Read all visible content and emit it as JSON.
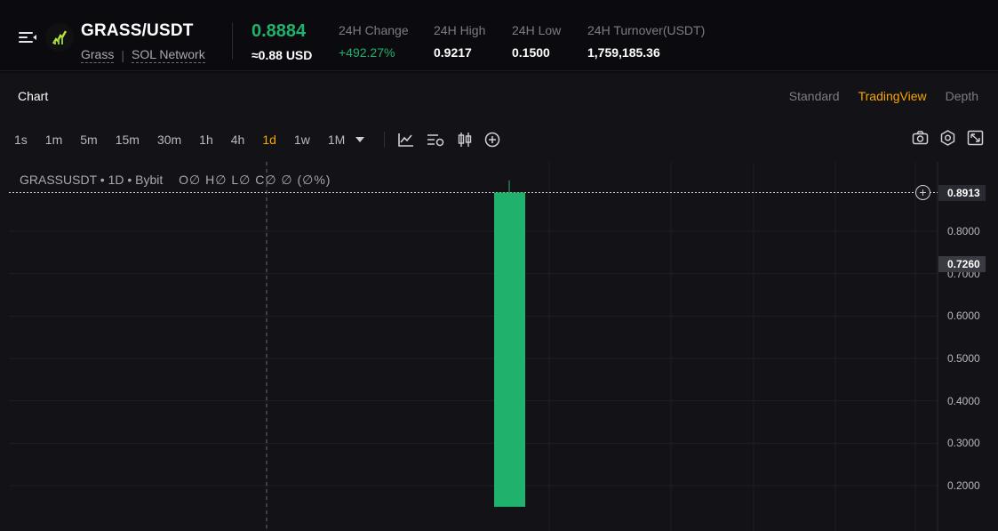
{
  "header": {
    "pair": "GRASS/USDT",
    "token_name": "Grass",
    "network": "SOL Network",
    "price": "0.8884",
    "price_usd": "≈0.88 USD",
    "stats": [
      {
        "label": "24H Change",
        "value": "+492.27%"
      },
      {
        "label": "24H High",
        "value": "0.9217"
      },
      {
        "label": "24H Low",
        "value": "0.1500"
      },
      {
        "label": "24H Turnover(USDT)",
        "value": "1,759,185.36"
      }
    ]
  },
  "chart_panel": {
    "title": "Chart",
    "views": [
      "Standard",
      "TradingView",
      "Depth"
    ],
    "active_view": "TradingView",
    "timeframes": [
      "1s",
      "1m",
      "5m",
      "15m",
      "30m",
      "1h",
      "4h",
      "1d",
      "1w",
      "1M"
    ],
    "active_timeframe": "1d",
    "icons": [
      "indicator-icon",
      "chart-settings-icon",
      "candle-type-icon",
      "add-icon"
    ],
    "right_icons": [
      "camera-icon",
      "settings-icon",
      "fullscreen-icon"
    ]
  },
  "chart_data": {
    "type": "candlestick",
    "symbol": "GRASSUSDT",
    "interval": "1D",
    "exchange": "Bybit",
    "legend_ohlc": "O∅ H∅ L∅ C∅ ∅ (∅%)",
    "y_ticks": [
      "0.8000",
      "0.7000",
      "0.6000",
      "0.5000",
      "0.4000",
      "0.3000",
      "0.2000"
    ],
    "ylim": [
      0.15,
      0.95
    ],
    "last_price_tag": "0.8913",
    "crosshair_price_tag": "0.7260",
    "candles": [
      {
        "open": 0.15,
        "high": 0.92,
        "low": 0.15,
        "close": 0.8913
      }
    ],
    "colors": {
      "up": "#20b26c",
      "accent": "#f7a600"
    }
  }
}
